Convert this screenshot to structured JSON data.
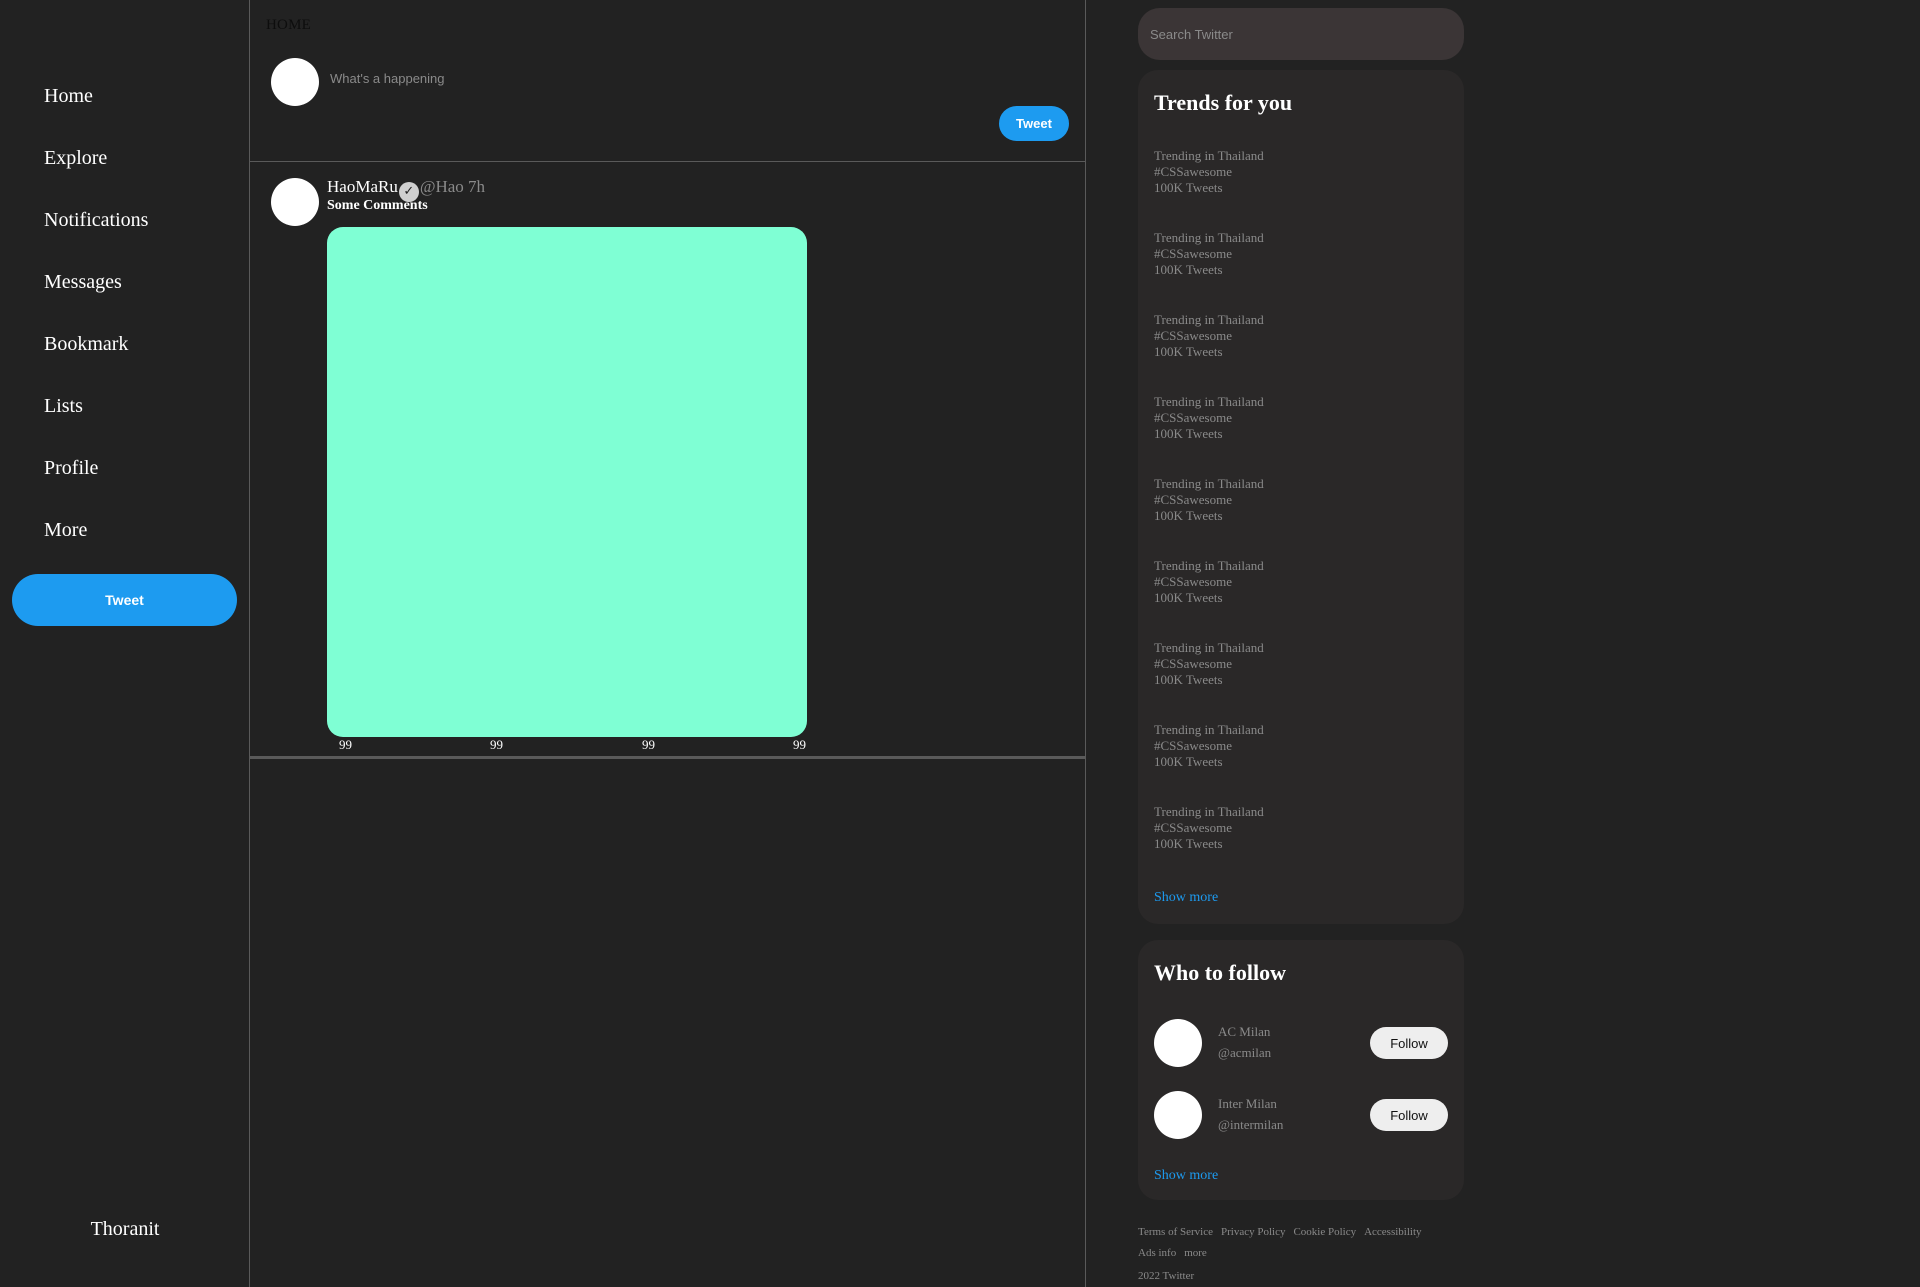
{
  "nav": {
    "items": [
      {
        "label": "Home"
      },
      {
        "label": "Explore"
      },
      {
        "label": "Notifications"
      },
      {
        "label": "Messages"
      },
      {
        "label": "Bookmark"
      },
      {
        "label": "Lists"
      },
      {
        "label": "Profile"
      },
      {
        "label": "More"
      }
    ],
    "tweet_label": "Tweet",
    "username": "Thoranit"
  },
  "main": {
    "title": "HOME",
    "compose": {
      "placeholder": "What's a happening",
      "tweet_label": "Tweet"
    },
    "post": {
      "name": "HaoMaRu",
      "verified_icon": "✓",
      "handle_time": "@Hao 7h",
      "text": "Some Comments",
      "media_color": "#7fffd4",
      "stats": [
        "99",
        "99",
        "99",
        "99"
      ]
    }
  },
  "search": {
    "placeholder": "Search Twitter"
  },
  "trends": {
    "title": "Trends for you",
    "items": [
      {
        "location": "Trending in Thailand",
        "tag": "#CSSawesome",
        "count": "100K Tweets"
      },
      {
        "location": "Trending in Thailand",
        "tag": "#CSSawesome",
        "count": "100K Tweets"
      },
      {
        "location": "Trending in Thailand",
        "tag": "#CSSawesome",
        "count": "100K Tweets"
      },
      {
        "location": "Trending in Thailand",
        "tag": "#CSSawesome",
        "count": "100K Tweets"
      },
      {
        "location": "Trending in Thailand",
        "tag": "#CSSawesome",
        "count": "100K Tweets"
      },
      {
        "location": "Trending in Thailand",
        "tag": "#CSSawesome",
        "count": "100K Tweets"
      },
      {
        "location": "Trending in Thailand",
        "tag": "#CSSawesome",
        "count": "100K Tweets"
      },
      {
        "location": "Trending in Thailand",
        "tag": "#CSSawesome",
        "count": "100K Tweets"
      },
      {
        "location": "Trending in Thailand",
        "tag": "#CSSawesome",
        "count": "100K Tweets"
      }
    ],
    "show_more": "Show more"
  },
  "who_to_follow": {
    "title": "Who to follow",
    "accounts": [
      {
        "name": "AC Milan",
        "handle": "@acmilan",
        "button": "Follow"
      },
      {
        "name": "Inter Milan",
        "handle": "@intermilan",
        "button": "Follow"
      }
    ],
    "show_more": "Show more"
  },
  "footer": {
    "links": [
      "Terms of Service",
      "Privacy Policy",
      "Cookie Policy",
      "Accessibility",
      "Ads info",
      "more"
    ],
    "copyright": "2022 Twitter"
  },
  "colors": {
    "background": "#222222",
    "accent": "#1d9bf0",
    "card": "#2a2828",
    "search": "#3b3536"
  }
}
